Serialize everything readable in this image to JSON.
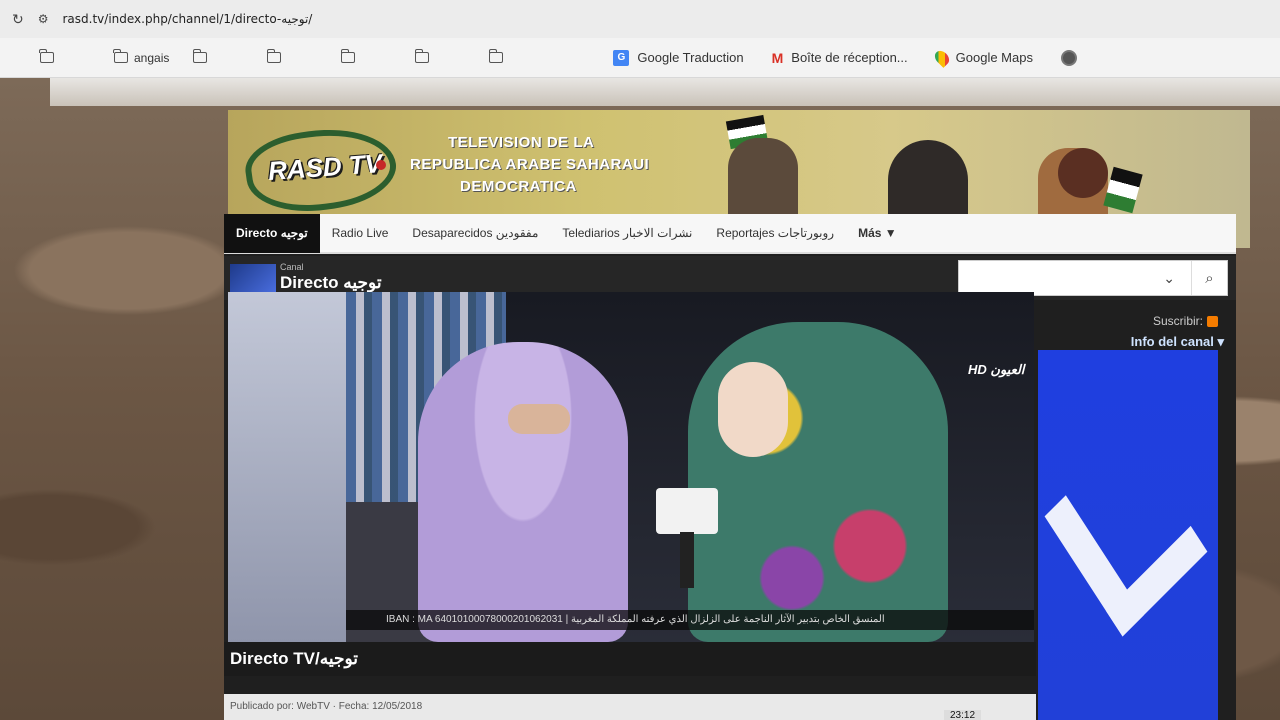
{
  "browser": {
    "url": "rasd.tv/index.php/channel/1/directo-توجيه/",
    "bookmarks": {
      "folder_label": "angais",
      "links": [
        {
          "label": "Google Traduction",
          "icon": "translate-icon"
        },
        {
          "label": "Boîte de réception...",
          "icon": "gmail-icon"
        },
        {
          "label": "Google Maps",
          "icon": "maps-icon"
        }
      ]
    }
  },
  "banner": {
    "logo_text": "RASD TV",
    "line1": "TELEVISION DE LA",
    "line2": "REPUBLICA ARABE SAHARAUI",
    "line3": "DEMOCRATICA"
  },
  "nav": {
    "items": [
      {
        "label": "Directo توجيه",
        "active": true
      },
      {
        "label": "Radio Live"
      },
      {
        "label": "Desaparecidos مفقودين"
      },
      {
        "label": "Telediarios نشرات الاخبار"
      },
      {
        "label": "Reportajes روبورتاجات"
      },
      {
        "label": "Más ▼"
      }
    ]
  },
  "channel": {
    "label": "Canal",
    "title": "Directo توجيه",
    "subscribe": "Suscribir:",
    "info": "Info del canal ▾"
  },
  "video": {
    "channel_logo": "HD العيون",
    "ticker": "IBAN : MA 64010100078000201062031 | المنسق الخاص بتدبير الآثار الناجمة على الزلزال الذي عرفته المملكة المغربية"
  },
  "footer": {
    "title": "Directo TV/توجيه",
    "meta": "Publicado por: WebTV · Fecha: 12/05/2018",
    "time": "23:12"
  }
}
